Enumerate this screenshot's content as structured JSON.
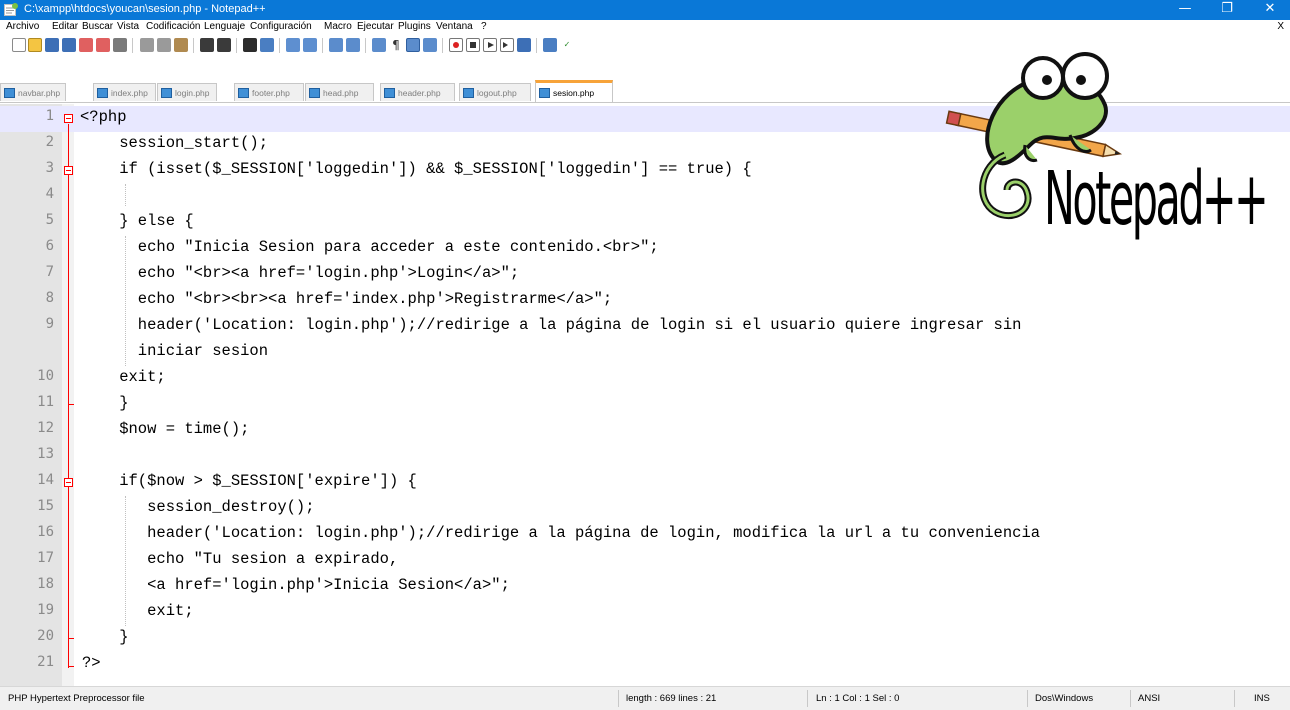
{
  "window": {
    "title": "C:\\xampp\\htdocs\\youcan\\sesion.php - Notepad++",
    "minimize_glyph": "—",
    "maximize_glyph": "❐",
    "close_glyph": "✕"
  },
  "menu": {
    "items": [
      "Archivo",
      "Editar",
      "Buscar",
      "Vista",
      "Codificación",
      "Lenguaje",
      "Configuración",
      "Macro",
      "Ejecutar",
      "Plugins",
      "Ventana",
      "?"
    ],
    "close_doc": "X"
  },
  "toolbar": {
    "icons": [
      "new-file-icon",
      "open-file-icon",
      "save-icon",
      "save-all-icon",
      "close-icon",
      "close-all-icon",
      "print-icon",
      "cut-icon",
      "copy-icon",
      "paste-icon",
      "undo-icon",
      "redo-icon",
      "find-icon",
      "replace-icon",
      "zoom-in-icon",
      "zoom-out-icon",
      "sync-vertical-icon",
      "sync-horizontal-icon",
      "word-wrap-icon",
      "show-all-chars-icon",
      "indent-guide-icon",
      "doc-map-icon",
      "record-macro-icon",
      "stop-macro-icon",
      "play-macro-icon",
      "run-macro-multiple-icon",
      "save-macro-icon",
      "spell-check-icon"
    ]
  },
  "tabs": [
    {
      "label": "navbar.php",
      "active": false
    },
    {
      "label": "index.php",
      "active": false
    },
    {
      "label": "login.php",
      "active": false
    },
    {
      "label": "footer.php",
      "active": false
    },
    {
      "label": "head.php",
      "active": false
    },
    {
      "label": "header.php",
      "active": false
    },
    {
      "label": "logout.php",
      "active": false
    },
    {
      "label": "sesion.php",
      "active": true
    }
  ],
  "editor": {
    "line_numbers": [
      "1",
      "2",
      "3",
      "4",
      "5",
      "6",
      "7",
      "8",
      "9",
      "",
      "10",
      "11",
      "12",
      "13",
      "14",
      "15",
      "16",
      "17",
      "18",
      "19",
      "20",
      "21"
    ],
    "code_lines": [
      "<?php",
      "    session_start();",
      "    if (isset($_SESSION['loggedin']) && $_SESSION['loggedin'] == true) {",
      "",
      "    } else {",
      "      echo \"Inicia Sesion para acceder a este contenido.<br>\";",
      "      echo \"<br><a href='login.php'>Login</a>\";",
      "      echo \"<br><br><a href='index.php'>Registrarme</a>\";",
      "      header('Location: login.php');//redirige a la página de login si el usuario quiere ingresar sin",
      "      iniciar sesion",
      "    exit;",
      "    }",
      "    $now = time();",
      "",
      "    if($now > $_SESSION['expire']) {",
      "       session_destroy();",
      "       header('Location: login.php');//redirige a la página de login, modifica la url a tu conveniencia",
      "       echo \"Tu sesion a expirado,",
      "       <a href='login.php'>Inicia Sesion</a>\";",
      "       exit;",
      "    }",
      "?>"
    ]
  },
  "logo": {
    "wordmark": "Notepad++"
  },
  "status": {
    "file_type": "PHP Hypertext Preprocessor file",
    "length_lines": "length : 669    lines : 21",
    "position": "Ln : 1    Col : 1    Sel : 0",
    "eol": "Dos\\Windows",
    "encoding": "ANSI",
    "mode": "INS"
  },
  "colors": {
    "titlebar": "#0a78d7",
    "keyword": "#00007f",
    "string": "#808080",
    "comment": "#008000",
    "php_tag": "#ff0000",
    "active_tab_accent": "#f7a339",
    "current_line": "#e8e8ff"
  }
}
